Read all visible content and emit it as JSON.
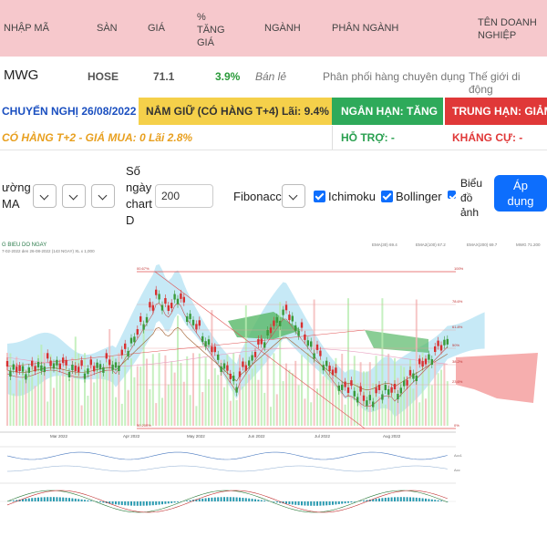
{
  "header": {
    "col_code": "NHẬP MÃ",
    "col_exchange": "SÀN",
    "col_price": "GIÁ",
    "col_change": "% TĂNG GIÁ",
    "col_industry": "NGÀNH",
    "col_subindustry": "PHÂN NGÀNH",
    "col_company": "TÊN DOANH NGHIỆP"
  },
  "row": {
    "code": "MWG",
    "exchange": "HOSE",
    "price": "71.1",
    "change": "3.9%",
    "industry": "Bán lẻ",
    "subindustry": "Phân phối hàng chuyên dụng",
    "company": "Thế giới di động"
  },
  "signals": {
    "recommend": "CHUYỂN NGHỊ 26/08/2022",
    "hold": "NẮM GIỮ (CÓ HÀNG T+4) Lãi: 9.4%",
    "short_term": "NGẮN HẠN: TĂNG",
    "mid_term": "TRUNG HẠN: GIẢM",
    "t2_note": "CÓ HÀNG T+2 - GIÁ MUA: 0 Lãi 2.8%",
    "support": "HỖ TRỢ: -",
    "resistance": "KHÁNG CỰ: -"
  },
  "controls": {
    "trend_label_1": "ường",
    "trend_label_2": "MA",
    "days_label": [
      "Số",
      "ngày",
      "chart",
      "D"
    ],
    "days_value": "200",
    "fibonacci": "Fibonacci",
    "ichimoku": "Ichimoku",
    "bollinger": "Bollinger",
    "chart_type_label": [
      "Biểu",
      "đồ",
      "ảnh"
    ],
    "apply": [
      "Áp",
      "dụng"
    ]
  },
  "chart": {
    "title": "G BIEU DO NGAY",
    "subtitle": "7-02-2022 den 26-08-2022 (143 NGAY) XL x 1,000",
    "legend": [
      "EMA(30) 69.4",
      "EMA2(100) 67.2",
      "EMAX(200) 69.7",
      "MWG 71.200"
    ],
    "months": [
      "Mar 2022",
      "Apr 2022",
      "May 2022",
      "Jun 2022",
      "Jul 2022",
      "Aug 2022"
    ],
    "fib_labels": [
      "00.67%",
      "100%",
      "78.6%",
      "61.8%",
      "50%",
      "38.2%",
      "23.6%",
      "50.200%",
      "0%"
    ],
    "osc_labels": [
      "Acc1",
      "Acc"
    ],
    "colors": {
      "up": "#3a9a3a",
      "down": "#d83030",
      "cloud_blue": "#b8e4f4",
      "cloud_red": "#f4a0a0",
      "cloud_green": "#58b868",
      "volume_green": "#b8ecb0",
      "volume_red": "#f4b8b8",
      "fib_line": "#e05050"
    }
  }
}
